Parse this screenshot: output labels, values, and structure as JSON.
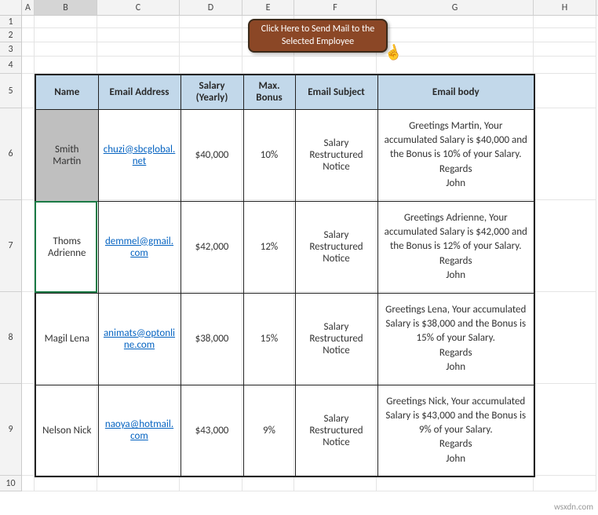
{
  "columns": [
    "A",
    "B",
    "C",
    "D",
    "E",
    "F",
    "G",
    "H"
  ],
  "selected_column": "B",
  "rows": [
    "1",
    "2",
    "3",
    "4",
    "5",
    "6",
    "7",
    "8",
    "9",
    "10"
  ],
  "active_cell": "B7",
  "macro_button": {
    "label": "Click Here to Send Mail to the Selected Employee"
  },
  "table": {
    "headers": {
      "name": "Name",
      "email": "Email Address",
      "salary": "Salary (Yearly)",
      "bonus": "Max. Bonus",
      "subject": "Email Subject",
      "body": "Email body"
    },
    "rows": [
      {
        "name": "Smith Martin",
        "email": "chuzi@sbcglobal.net",
        "salary": "$40,000",
        "bonus": "10%",
        "subject": "Salary Restructured Notice",
        "body": "Greetings Martin, Your accumulated Salary is $40,000 and the Bonus is 10% of your Salary. Regards John",
        "selected": true
      },
      {
        "name": "Thoms Adrienne",
        "email": "demmel@gmail.com",
        "salary": "$42,000",
        "bonus": "12%",
        "subject": "Salary Restructured Notice",
        "body": "Greetings Adrienne, Your accumulated Salary is $42,000 and the Bonus is 12% of your Salary. Regards John",
        "selected": false
      },
      {
        "name": "Magil Lena",
        "email": "animats@optonline.com",
        "salary": "$38,000",
        "bonus": "15%",
        "subject": "Salary Restructured Notice",
        "body": "Greetings Lena, Your accumulated Salary is $38,000 and the Bonus is 15% of your Salary. Regards John",
        "selected": false
      },
      {
        "name": "Nelson Nick",
        "email": "naoya@hotmail.com",
        "salary": "$43,000",
        "bonus": "9%",
        "subject": "Salary Restructured Notice",
        "body": "Greetings Nick, Your accumulated Salary is $43,000 and the Bonus is 9% of your Salary. Regards John",
        "selected": false
      }
    ]
  },
  "watermark": "wsxdn.com"
}
